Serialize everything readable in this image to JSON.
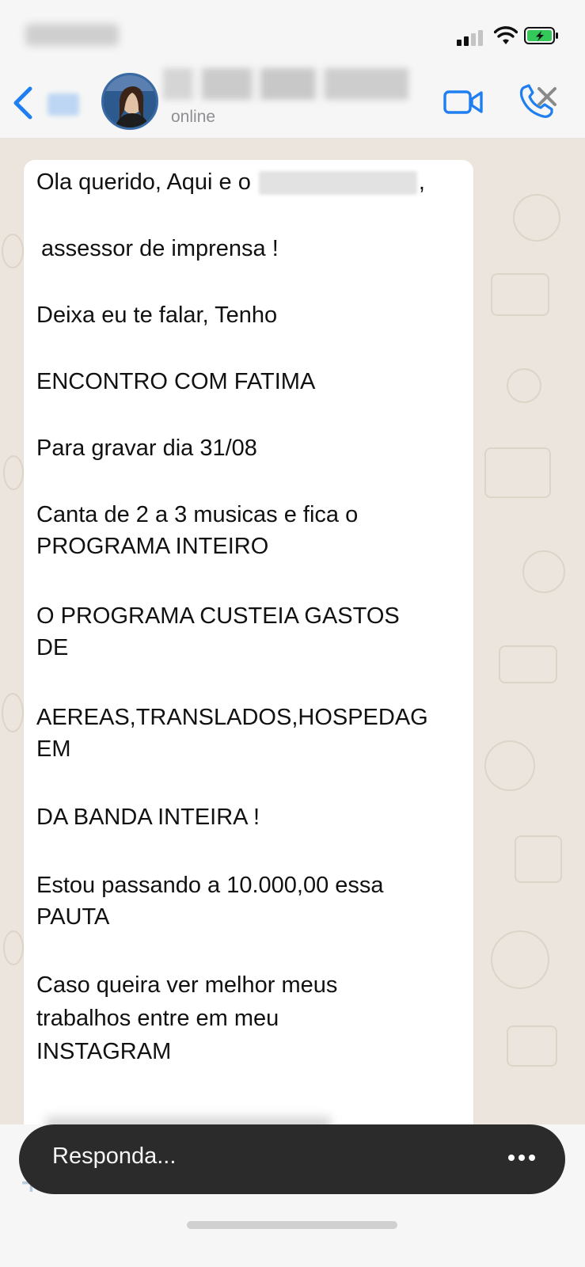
{
  "header": {
    "contact_status": "online"
  },
  "message": {
    "lines": [
      "Ola querido, Aqui e o",
      "assessor de imprensa !",
      "Deixa eu te falar, Tenho",
      "ENCONTRO COM FATIMA",
      "Para gravar dia 31/08",
      "Canta de 2 a 3 musicas e fica o",
      "PROGRAMA INTEIRO",
      "O PROGRAMA CUSTEIA GASTOS",
      "DE",
      "AEREAS,TRANSLADOS,HOSPEDAG",
      "EM",
      "DA BANDA INTEIRA !",
      "Estou passando a 10.000,00 essa",
      "PAUTA",
      "Caso queira ver melhor meus",
      "trabalhos entre em meu",
      "INSTAGRAM"
    ],
    "first_line_suffix": ","
  },
  "reply_bar": {
    "placeholder": "Responda..."
  },
  "icons": {
    "back": "chevron-left-icon",
    "video": "video-camera-icon",
    "call": "phone-icon",
    "close": "close-icon",
    "more": "ellipsis-icon",
    "attach": "plus-icon",
    "camera": "camera-icon",
    "mic": "microphone-icon"
  },
  "colors": {
    "accent": "#1f7ef0",
    "chat_background": "#ece5dd",
    "reply_bar": "#2b2b2b",
    "battery": "#34c759"
  }
}
